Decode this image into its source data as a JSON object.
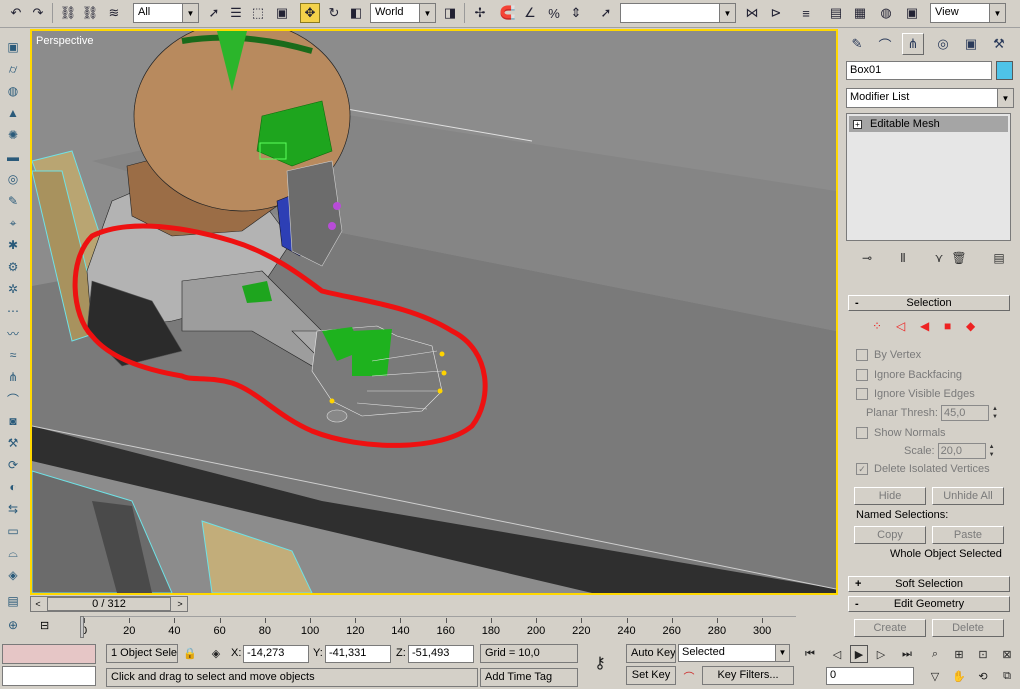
{
  "toolbar": {
    "selection_filter": "All",
    "coord_system": "World",
    "named_selection": "",
    "view_dropdown": "View"
  },
  "viewport": {
    "label": "Perspective"
  },
  "command_panel": {
    "object_name": "Box01",
    "object_color": "#4ec3e8",
    "modifier_list": "Modifier List",
    "stack_item": "Editable Mesh",
    "selection_rollout": {
      "title": "Selection",
      "by_vertex": "By Vertex",
      "ignore_backfacing": "Ignore Backfacing",
      "ignore_visible_edges": "Ignore Visible Edges",
      "planar_thresh_label": "Planar Thresh:",
      "planar_thresh_value": "45,0",
      "show_normals": "Show Normals",
      "scale_label": "Scale:",
      "scale_value": "20,0",
      "delete_isolated": "Delete Isolated Vertices",
      "hide": "Hide",
      "unhide_all": "Unhide All",
      "named_selections": "Named Selections:",
      "copy": "Copy",
      "paste": "Paste",
      "status": "Whole Object Selected"
    },
    "soft_selection": "Soft Selection",
    "edit_geometry": "Edit Geometry",
    "create": "Create",
    "delete": "Delete"
  },
  "timeline": {
    "position": "0 / 312",
    "ticks": [
      "0",
      "20",
      "40",
      "60",
      "80",
      "100",
      "120",
      "140",
      "160",
      "180",
      "200",
      "220",
      "240",
      "260",
      "280",
      "300"
    ]
  },
  "status": {
    "objects": "1 Object Sele",
    "x_label": "X:",
    "x_value": "-14,273",
    "y_label": "Y:",
    "y_value": "-41,331",
    "z_label": "Z:",
    "z_value": "-51,493",
    "grid": "Grid = 10,0",
    "prompt": "Click and drag to select and move objects",
    "add_time_tag": "Add Time Tag",
    "auto_key": "Auto Key",
    "set_key": "Set Key",
    "key_mode": "Selected",
    "key_filters": "Key Filters...",
    "frame": "0"
  }
}
